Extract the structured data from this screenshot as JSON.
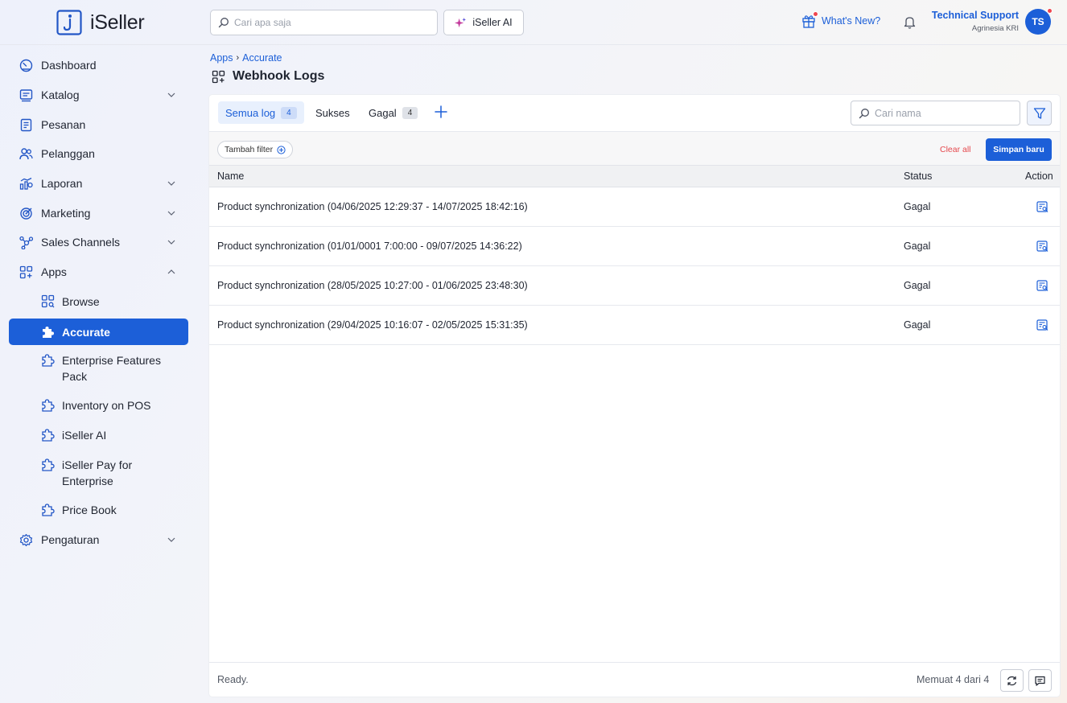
{
  "app": {
    "name": "iSeller"
  },
  "header": {
    "search_placeholder": "Cari apa saja",
    "ai_button_label": "iSeller AI",
    "whats_new_label": "What's New?",
    "user_name": "Technical Support",
    "user_org": "Agrinesia KRI",
    "avatar_initials": "TS"
  },
  "sidebar": {
    "items": [
      {
        "label": "Dashboard",
        "icon": "dashboard-icon"
      },
      {
        "label": "Katalog",
        "icon": "catalog-icon",
        "expandable": true
      },
      {
        "label": "Pesanan",
        "icon": "orders-icon"
      },
      {
        "label": "Pelanggan",
        "icon": "customers-icon"
      },
      {
        "label": "Laporan",
        "icon": "reports-icon",
        "expandable": true
      },
      {
        "label": "Marketing",
        "icon": "marketing-icon",
        "expandable": true
      },
      {
        "label": "Sales Channels",
        "icon": "sales-channels-icon",
        "expandable": true
      },
      {
        "label": "Apps",
        "icon": "apps-icon",
        "expandable": true,
        "expanded": true
      },
      {
        "label": "Pengaturan",
        "icon": "settings-gear-icon",
        "expandable": true
      }
    ],
    "apps_sub": [
      {
        "label": "Browse",
        "icon": "browse-icon"
      },
      {
        "label": "Accurate",
        "icon": "puzzle-icon",
        "active": true
      },
      {
        "label": "Enterprise Features Pack",
        "icon": "puzzle-icon"
      },
      {
        "label": "Inventory on POS",
        "icon": "puzzle-icon"
      },
      {
        "label": "iSeller AI",
        "icon": "puzzle-icon"
      },
      {
        "label": "iSeller Pay for Enterprise",
        "icon": "puzzle-icon"
      },
      {
        "label": "Price Book",
        "icon": "puzzle-icon"
      }
    ]
  },
  "breadcrumb": {
    "parent": "Apps",
    "separator": "›",
    "current": "Accurate"
  },
  "page": {
    "title": "Webhook Logs"
  },
  "tabs": [
    {
      "label": "Semua log",
      "count": "4",
      "active": true
    },
    {
      "label": "Sukses",
      "count": ""
    },
    {
      "label": "Gagal",
      "count": "4"
    }
  ],
  "toolbar": {
    "name_search_placeholder": "Cari nama",
    "add_filter_label": "Tambah filter",
    "clear_all_label": "Clear all",
    "save_new_label": "Simpan baru"
  },
  "table": {
    "columns": {
      "name": "Name",
      "status": "Status",
      "action": "Action"
    },
    "rows": [
      {
        "name": "Product synchronization (04/06/2025 12:29:37 - 14/07/2025 18:42:16)",
        "status": "Gagal"
      },
      {
        "name": "Product synchronization (01/01/0001 7:00:00 - 09/07/2025 14:36:22)",
        "status": "Gagal"
      },
      {
        "name": "Product synchronization (28/05/2025 10:27:00 - 01/06/2025 23:48:30)",
        "status": "Gagal"
      },
      {
        "name": "Product synchronization (29/04/2025 10:16:07 - 02/05/2025 15:31:35)",
        "status": "Gagal"
      }
    ]
  },
  "footer": {
    "status": "Ready.",
    "loaded": "Memuat 4 dari 4"
  },
  "colors": {
    "accent": "#1c5fd8",
    "danger": "#e5484d",
    "notification_dot": "#f0454d"
  }
}
